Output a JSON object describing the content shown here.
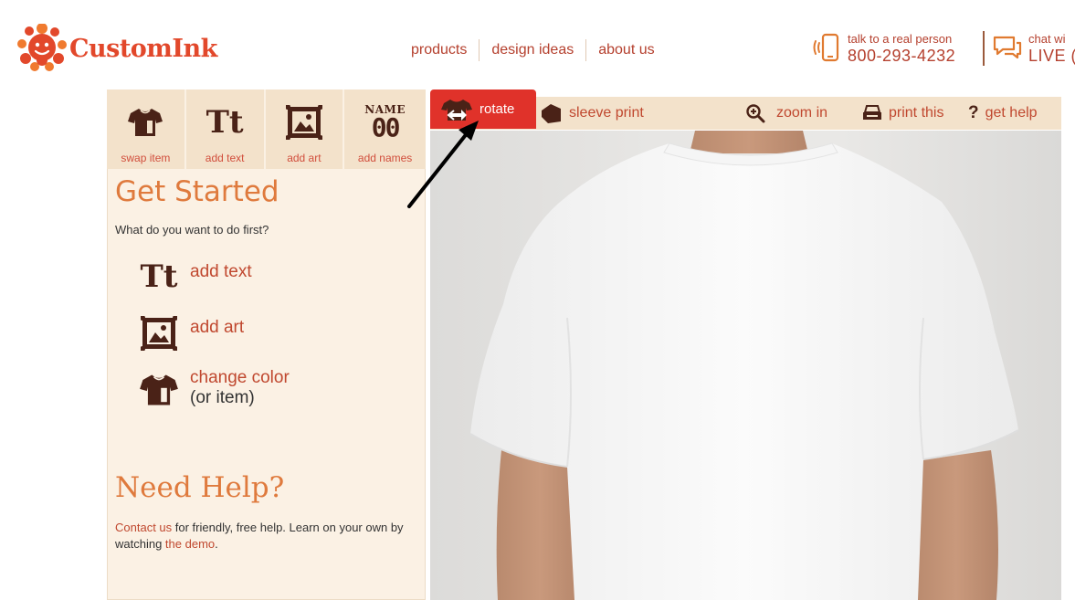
{
  "header": {
    "logo_text": "CustomInk",
    "nav": [
      "products",
      "design ideas",
      "about us"
    ],
    "phone_label": "talk to a real person",
    "phone_number": "800-293-4232",
    "chat_label": "chat wi",
    "chat_live": "LIVE ("
  },
  "tools": [
    {
      "label": "swap item",
      "icon": "tshirt-icon"
    },
    {
      "label": "add text",
      "icon": "text-icon"
    },
    {
      "label": "add art",
      "icon": "picture-frame-icon"
    },
    {
      "label": "add names",
      "icon": "name-number-icon",
      "glyph_top": "NAME",
      "glyph_bottom": "00"
    }
  ],
  "tt_glyph": "Tt",
  "left": {
    "get_started": "Get Started",
    "question": "What do you want to do first?",
    "options": [
      {
        "label": "add text",
        "icon": "text-icon"
      },
      {
        "label": "add art",
        "icon": "picture-frame-icon"
      },
      {
        "label": "change color",
        "secondary": "(or item)",
        "icon": "tshirt-icon"
      }
    ],
    "need_help": "Need Help?",
    "help_link1": "Contact us",
    "help_mid": " for friendly, free help. Learn on your own by watching ",
    "help_link2": "the demo",
    "help_end": "."
  },
  "toolbar": {
    "rotate": "rotate",
    "sleeve": "sleeve print",
    "zoom": "zoom in",
    "print": "print this",
    "help_icon": "?",
    "help": "get help"
  },
  "colors": {
    "brand": "#e2482b",
    "accent_orange": "#df7a3d",
    "link_red": "#c0482f",
    "panel_bg": "#fbf1e4",
    "tool_bg": "#f3e2cb",
    "icon_brown": "#4a2217",
    "rotate_red": "#e0322a"
  }
}
